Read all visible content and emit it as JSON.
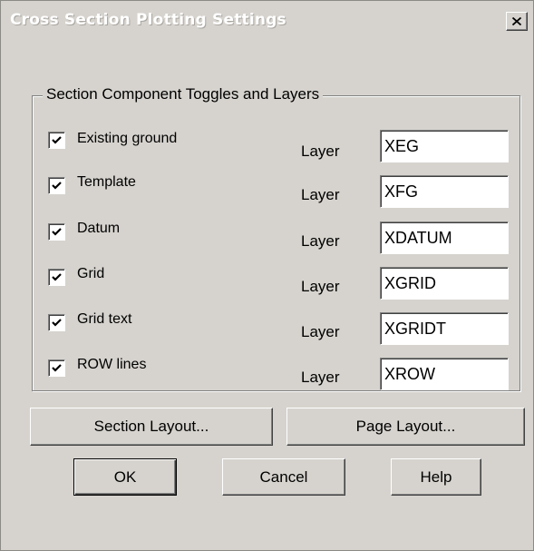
{
  "window": {
    "title": "Cross Section Plotting Settings",
    "close_icon": "close-icon"
  },
  "group": {
    "legend": "Section Component Toggles and Layers"
  },
  "rows": [
    {
      "label": "Existing ground",
      "checked": true,
      "layer_label": "Layer",
      "layer_value": "XEG"
    },
    {
      "label": "Template",
      "checked": true,
      "layer_label": "Layer",
      "layer_value": "XFG"
    },
    {
      "label": "Datum",
      "checked": true,
      "layer_label": "Layer",
      "layer_value": "XDATUM"
    },
    {
      "label": "Grid",
      "checked": true,
      "layer_label": "Layer",
      "layer_value": "XGRID"
    },
    {
      "label": "Grid text",
      "checked": true,
      "layer_label": "Layer",
      "layer_value": "XGRIDT"
    },
    {
      "label": "ROW lines",
      "checked": true,
      "layer_label": "Layer",
      "layer_value": "XROW"
    }
  ],
  "buttons": {
    "section_layout": "Section Layout...",
    "page_layout": "Page Layout...",
    "ok": "OK",
    "cancel": "Cancel",
    "help": "Help"
  }
}
